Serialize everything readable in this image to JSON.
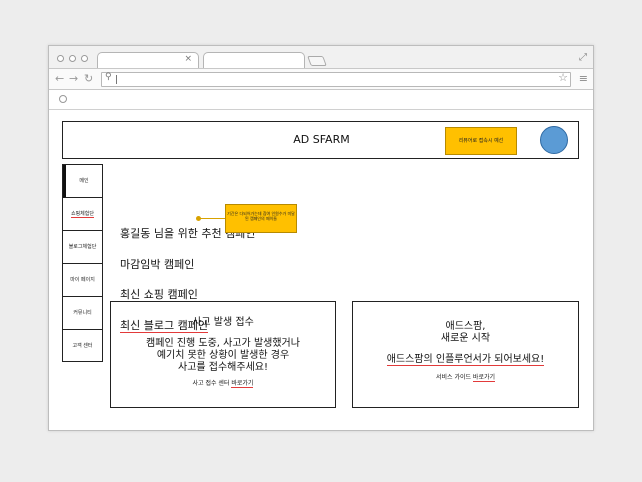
{
  "header": {
    "logo": "AD SFARM",
    "sticky_note": "리뷰어로 접속시 예선"
  },
  "sidebar": {
    "items": [
      {
        "label": "메인"
      },
      {
        "label": "쇼핑체험단"
      },
      {
        "label": "블로그체험단"
      },
      {
        "label": "마이 페이지"
      },
      {
        "label": "커뮤니티"
      },
      {
        "label": "고객 센터"
      }
    ]
  },
  "main": {
    "campaigns": [
      {
        "title": "홍길동 님을 위한 추천 캠페인"
      },
      {
        "title": "마감임박 캠페인"
      },
      {
        "title": "최신 쇼핑 캠페인"
      },
      {
        "title": "최신 블로그 캠페인"
      }
    ],
    "sticky_note": "기간은 다되어가는데 참여 인원수가 미달된 캠페인의 페이들"
  },
  "cards": {
    "accident": {
      "title": "사고 발생 접수",
      "body_line1": "캠페인 진행 도중, 사고가 발생했거나",
      "body_line2": "예기치 못한 상황이 발생한 경우",
      "body_line3": "사고를 접수해주세요!",
      "link_prefix": "사고 접수 센터 ",
      "link_label": "바로가기"
    },
    "influencer": {
      "title_line1": "애드스팜,",
      "title_line2": "새로운 시작",
      "headline": "애드스팜의 인플루언서가 되어보세요!",
      "link_prefix": "서비스 가이드 ",
      "link_label": "바로가기"
    }
  },
  "colors": {
    "sticky": "#ffc000",
    "avatar": "#5b9bd5",
    "spellcheck": "#e23a3a"
  }
}
